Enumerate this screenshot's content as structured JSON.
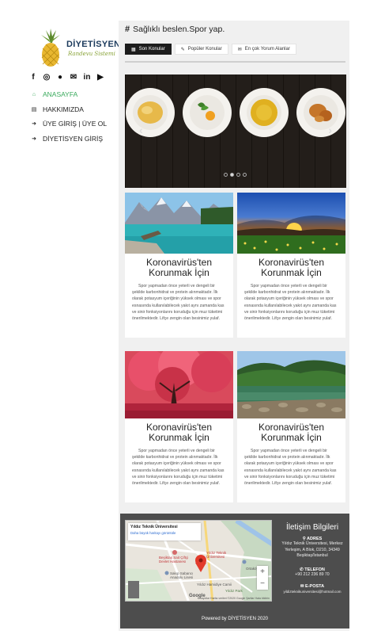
{
  "brand": {
    "title": "DİYETİSYEN",
    "subtitle": "Randevu Sistemi"
  },
  "social": [
    {
      "icon": "facebook-icon",
      "glyph": "f"
    },
    {
      "icon": "instagram-icon",
      "glyph": "◎"
    },
    {
      "icon": "snapchat-icon",
      "glyph": "●"
    },
    {
      "icon": "mail-icon",
      "glyph": "✉"
    },
    {
      "icon": "linkedin-icon",
      "glyph": "in"
    },
    {
      "icon": "youtube-icon",
      "glyph": "▶"
    }
  ],
  "nav": [
    {
      "label": "ANASAYFA",
      "icon": "home-icon",
      "glyph": "⌂",
      "active": true
    },
    {
      "label": "HAKKIMIZDA",
      "icon": "id-card-icon",
      "glyph": "▤",
      "active": false
    },
    {
      "label": "ÜYE GİRİŞ | ÜYE OL",
      "icon": "sign-in-icon",
      "glyph": "➜",
      "active": false
    },
    {
      "label": "DİYETİSYEN GİRİŞ",
      "icon": "sign-in-icon",
      "glyph": "➜",
      "active": false
    }
  ],
  "main": {
    "heading_icon": "#",
    "heading": "Sağlıklı beslen.Spor yap.",
    "tabs": [
      {
        "label": "Son Konular",
        "glyph": "▦"
      },
      {
        "label": "Popüler Konular",
        "glyph": "✎"
      },
      {
        "label": "En çok Yorum Alanlar",
        "glyph": "✉"
      }
    ]
  },
  "slider": {
    "prev": "‹",
    "next": "›",
    "active_index": 1,
    "count": 4
  },
  "cards": [
    {
      "title": "Koronavirüs'ten Korunmak İçin",
      "body": "Spor yapmadan önce yeterli ve dengeli bir şekilde karbonhidrat ve protein alınmaktadır. İlk olarak potasyum içeriğinin yüksek olması ve spor esnasında kullanılabilecek yakıt aynı zamanda kas ve sinir fonksiyonlarını koruduğu için muz tüketimi önerilmektedir. Lifçe zengin olan besinimiz yulaf."
    },
    {
      "title": "Koronavirüs'ten Korunmak İçin",
      "body": "Spor yapmadan önce yeterli ve dengeli bir şekilde karbonhidrat ve protein alınmaktadır. İlk olarak potasyum içeriğinin yüksek olması ve spor esnasında kullanılabilecek yakıt aynı zamanda kas ve sinir fonksiyonlarını koruduğu için muz tüketimi önerilmektedir. Lifçe zengin olan besinimiz yulaf."
    },
    {
      "title": "Koronavirüs'ten Korunmak İçin",
      "body": "Spor yapmadan önce yeterli ve dengeli bir şekilde karbonhidrat ve protein alınmaktadır. İlk olarak potasyum içeriğinin yüksek olması ve spor esnasında kullanılabilecek yakıt aynı zamanda kas ve sinir fonksiyonlarını koruduğu için muz tüketimi önerilmektedir. Lifçe zengin olan besinimiz yulaf."
    },
    {
      "title": "Koronavirüs'ten Korunmak İçin",
      "body": "Spor yapmadan önce yeterli ve dengeli bir şekilde karbonhidrat ve protein alınmaktadır. İlk olarak potasyum içeriğinin yüksek olması ve spor esnasında kullanılabilecek yakıt aynı zamanda kas ve sinir fonksiyonlarını koruduğu için muz tüketimi önerilmektedir. Lifçe zengin olan besinimiz yulaf."
    }
  ],
  "footer": {
    "map": {
      "place": "Yıldız Teknik Üniversitesi",
      "link": "Daha büyük haritayı görüntüle",
      "labels": [
        "Beşiktaş Sait Çiftçi Devlet Hastanesi",
        "Yıldız Teknik Üniversitesi",
        "Sakıp Sabancı Anadolu Lisesi",
        "Yıldız Hamidiye Camii",
        "Yıldız Park",
        "Ortaköy Muse"
      ],
      "zoom_in": "+",
      "zoom_out": "−",
      "google": "Google",
      "mapdata": "Kısayollar  Harita verileri ©2020 Google  Şartlar  Hata bildirin"
    },
    "contact_title": "İletişim Bilgileri",
    "address_label": "ADRES",
    "address": "Yıldız Teknik Üniversitesi, Merkez Yerleşim, A Blok, D210, 34349 Beşiktaş/İstanbul",
    "phone_label": "TELEFON",
    "phone": "+90 212 236 89 70",
    "email_label": "E-POSTA",
    "email": "yildizteknikuniversitesi@hotmail.com",
    "powered": "Powered by DİYETİSYEN 2020"
  },
  "colors": {
    "active_nav": "#3aaa5c",
    "footer_bg": "#4d4d4d",
    "main_bg": "#f0f0f0"
  }
}
